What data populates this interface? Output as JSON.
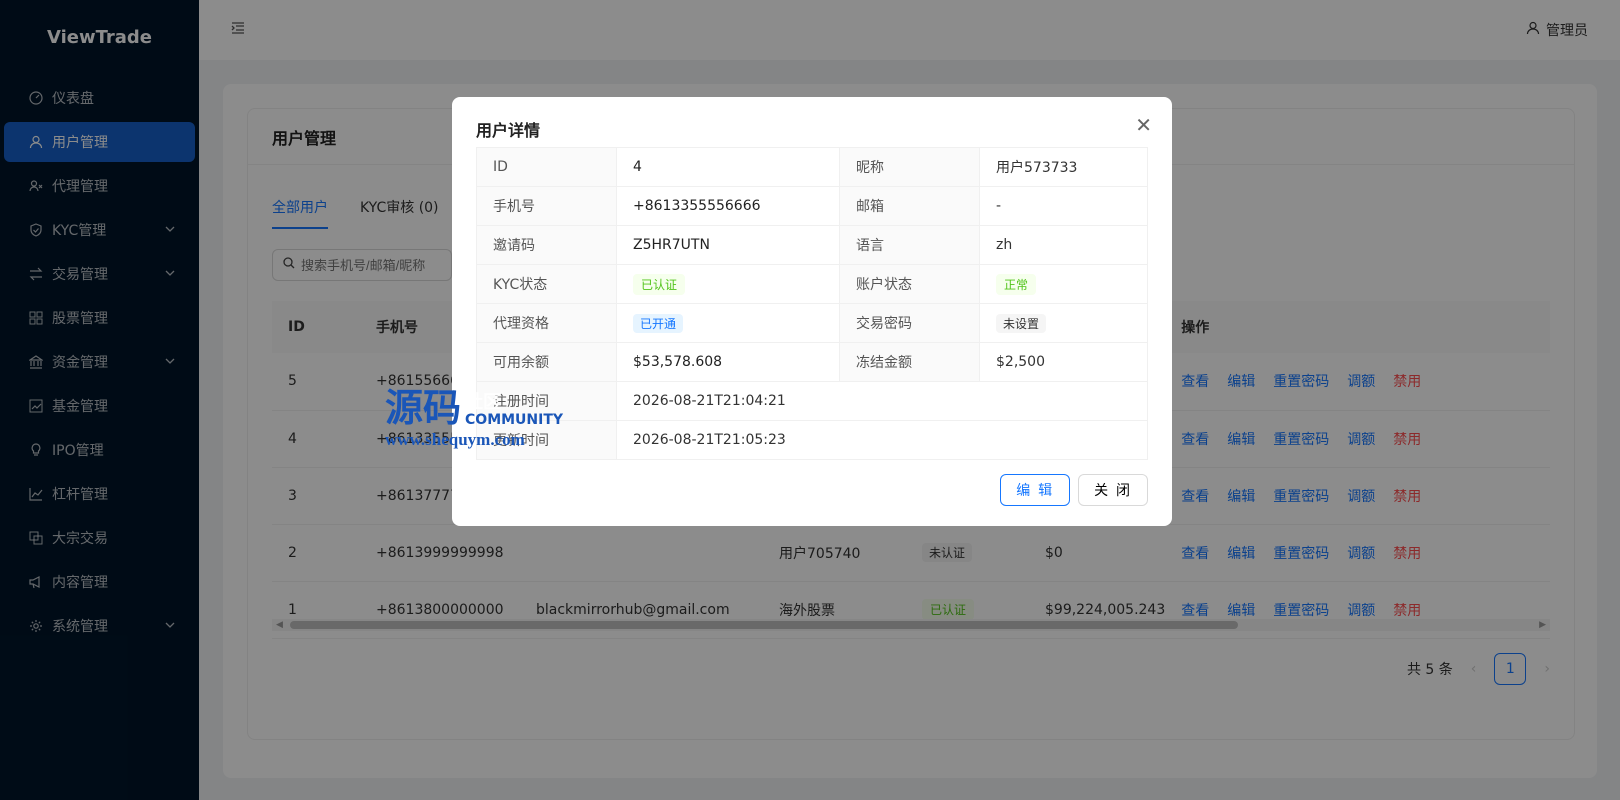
{
  "app": {
    "name": "ViewTrade"
  },
  "sidebar": {
    "items": [
      {
        "label": "仪表盘",
        "icon": "dashboard-icon"
      },
      {
        "label": "用户管理",
        "icon": "user-icon",
        "active": true
      },
      {
        "label": "代理管理",
        "icon": "agent-icon"
      },
      {
        "label": "KYC管理",
        "icon": "shield-icon",
        "has_children": true
      },
      {
        "label": "交易管理",
        "icon": "swap-icon",
        "has_children": true
      },
      {
        "label": "股票管理",
        "icon": "grid-icon"
      },
      {
        "label": "资金管理",
        "icon": "bank-icon",
        "has_children": true
      },
      {
        "label": "基金管理",
        "icon": "fund-chart-icon"
      },
      {
        "label": "IPO管理",
        "icon": "bulb-icon"
      },
      {
        "label": "杠杆管理",
        "icon": "line-chart-icon"
      },
      {
        "label": "大宗交易",
        "icon": "copy-icon"
      },
      {
        "label": "内容管理",
        "icon": "megaphone-icon"
      },
      {
        "label": "系统管理",
        "icon": "gear-icon",
        "has_children": true
      }
    ]
  },
  "header": {
    "user_label": "管理员"
  },
  "page": {
    "title": "用户管理",
    "tabs": [
      {
        "label": "全部用户",
        "active": true
      },
      {
        "label": "KYC审核 (0)"
      }
    ],
    "search_placeholder": "搜索手机号/邮箱/昵称"
  },
  "table": {
    "headers": {
      "id": "ID",
      "phone": "手机号",
      "actions": "操作"
    },
    "rows": [
      {
        "id": "5",
        "phone": "+861556666",
        "email": "",
        "nickname": "",
        "kyc": "",
        "balance": ""
      },
      {
        "id": "4",
        "phone": "+86133555",
        "email": "",
        "nickname": "",
        "kyc": "",
        "balance": ""
      },
      {
        "id": "3",
        "phone": "+86137777",
        "email": "",
        "nickname": "",
        "kyc": "",
        "balance": ""
      },
      {
        "id": "2",
        "phone": "+8613999999998",
        "email": "",
        "nickname": "用户705740",
        "kyc": "未认证",
        "kyc_style": "gray",
        "balance": "$0"
      },
      {
        "id": "1",
        "phone": "+8613800000000",
        "email": "blackmirrorhub@gmail.com",
        "nickname": "海外股票",
        "kyc": "已认证",
        "kyc_style": "green",
        "balance": "$99,224,005.243"
      }
    ],
    "actions": [
      "查看",
      "编辑",
      "重置密码",
      "调额",
      "禁用"
    ]
  },
  "pagination": {
    "total_text": "共 5 条",
    "current_page": "1"
  },
  "modal": {
    "title": "用户详情",
    "fields": {
      "id_label": "ID",
      "id_value": "4",
      "nickname_label": "昵称",
      "nickname_value": "用户573733",
      "phone_label": "手机号",
      "phone_value": "+8613355556666",
      "email_label": "邮箱",
      "email_value": "-",
      "invite_label": "邀请码",
      "invite_value": "Z5HR7UTN",
      "lang_label": "语言",
      "lang_value": "zh",
      "kyc_label": "KYC状态",
      "kyc_value": "已认证",
      "account_label": "账户状态",
      "account_value": "正常",
      "agent_label": "代理资格",
      "agent_value": "已开通",
      "trade_pwd_label": "交易密码",
      "trade_pwd_value": "未设置",
      "available_label": "可用余额",
      "available_value": "$53,578.608",
      "frozen_label": "冻结金额",
      "frozen_value": "$2,500",
      "created_label": "注册时间",
      "created_value": "2026-08-21T21:04:21",
      "updated_label": "更新时间",
      "updated_value": "2026-08-21T21:05:23"
    },
    "edit_button": "编 辑",
    "close_button": "关 闭"
  },
  "watermark": {
    "main": "源码",
    "sub": "社区",
    "en": "COMMUNITY",
    "url": "www.shequym.com"
  },
  "colors": {
    "sidebar_bg": "#001529",
    "primary": "#1677ff",
    "danger": "#ff4d4f",
    "success": "#52c41a"
  }
}
